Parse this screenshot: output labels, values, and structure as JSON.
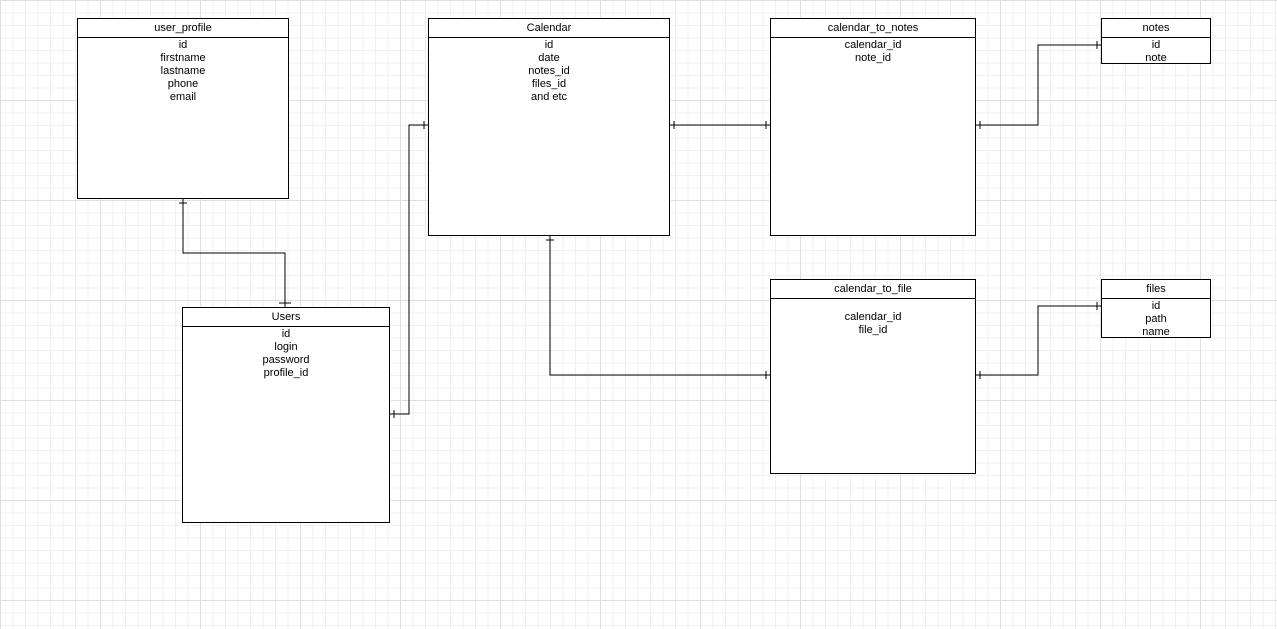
{
  "entities": {
    "user_profile": {
      "title": "user_profile",
      "fields": [
        "id",
        "firstname",
        "lastname",
        "phone",
        "email"
      ]
    },
    "users": {
      "title": "Users",
      "fields": [
        "id",
        "login",
        "password",
        "profile_id"
      ]
    },
    "calendar": {
      "title": "Calendar",
      "fields": [
        "id",
        "date",
        "notes_id",
        "files_id",
        "and etc"
      ]
    },
    "calendar_to_notes": {
      "title": "calendar_to_notes",
      "fields": [
        "calendar_id",
        "note_id"
      ]
    },
    "calendar_to_file": {
      "title": "calendar_to_file",
      "fields": [
        "calendar_id",
        "file_id"
      ]
    },
    "notes": {
      "title": "notes",
      "fields": [
        "id",
        "note"
      ]
    },
    "files": {
      "title": "files",
      "fields": [
        "id",
        "path",
        "name"
      ]
    }
  }
}
